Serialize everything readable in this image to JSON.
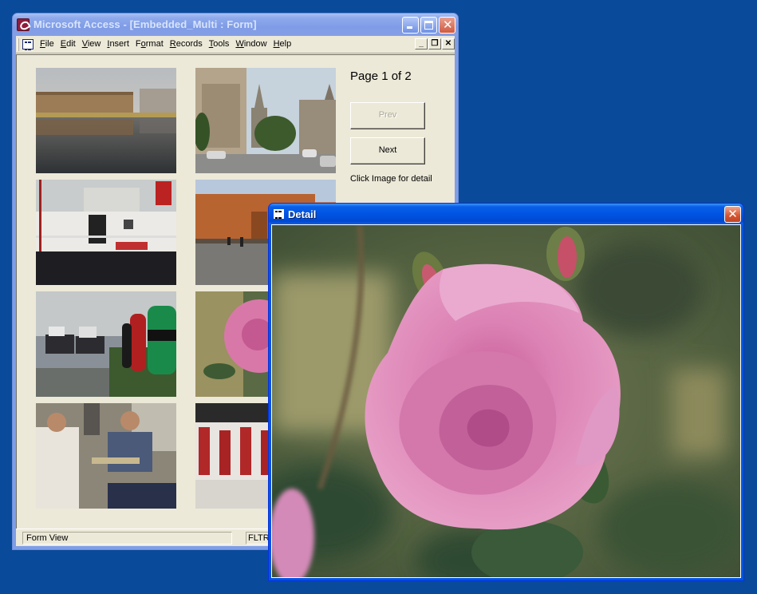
{
  "access_window": {
    "title": "Microsoft Access - [Embedded_Multi : Form]",
    "caption_buttons": {
      "minimize": "minimize",
      "maximize": "maximize",
      "close": "close"
    },
    "menu": [
      {
        "label": "File",
        "accel": "F",
        "rest": "ile"
      },
      {
        "label": "Edit",
        "accel": "E",
        "rest": "dit"
      },
      {
        "label": "View",
        "accel": "V",
        "rest": "iew"
      },
      {
        "label": "Insert",
        "accel": "I",
        "rest": "nsert"
      },
      {
        "label": "Format",
        "pre": "F",
        "accel": "o",
        "rest": "rmat"
      },
      {
        "label": "Records",
        "accel": "R",
        "rest": "ecords"
      },
      {
        "label": "Tools",
        "accel": "T",
        "rest": "ools"
      },
      {
        "label": "Window",
        "accel": "W",
        "rest": "indow"
      },
      {
        "label": "Help",
        "accel": "H",
        "rest": "elp"
      }
    ],
    "mdi_buttons": {
      "minimize": "_",
      "restore": "❐",
      "close": "✕"
    },
    "form": {
      "page_label": "Page 1 of 2",
      "prev_button": "Prev",
      "prev_enabled": false,
      "next_button": "Next",
      "hint": "Click Image for detail",
      "thumbnails": [
        {
          "subject": "warehouse reflected in canal"
        },
        {
          "subject": "gothic cathedral and town square"
        },
        {
          "subject": "moored white ship"
        },
        {
          "subject": "red brick palace"
        },
        {
          "subject": "tugboats beside colored buoys"
        },
        {
          "subject": "pink rose"
        },
        {
          "subject": "men playing chess"
        },
        {
          "subject": "soldiers in red uniforms"
        }
      ]
    },
    "status": {
      "text": "Form View",
      "indicator": "FLTR"
    }
  },
  "detail_window": {
    "title": "Detail",
    "close_glyph": "✕",
    "photo_subject": "pink rose with buds"
  },
  "colors": {
    "desktop": "#0a4a9a",
    "active_title": "#0054e3",
    "inactive_title": "#7f9ce6",
    "face": "#ece9d8"
  }
}
